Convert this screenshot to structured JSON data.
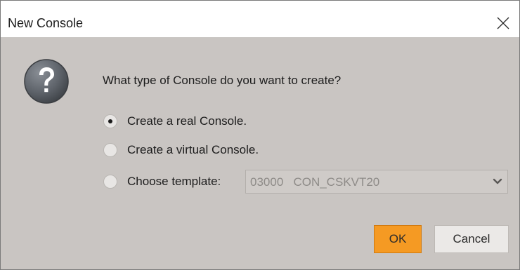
{
  "window": {
    "title": "New Console",
    "close_icon": "close-icon"
  },
  "dialog": {
    "icon": "question-icon",
    "prompt": "What type of Console do you want to create?",
    "options": [
      {
        "label": "Create a real Console.",
        "checked": true
      },
      {
        "label": "Create a virtual Console.",
        "checked": false
      },
      {
        "label": "Choose template:",
        "checked": false
      }
    ],
    "template_select": {
      "value": "03000   CON_CSKVT20",
      "enabled": false,
      "icon": "chevron-down-icon"
    }
  },
  "buttons": {
    "ok_label": "OK",
    "cancel_label": "Cancel"
  },
  "colors": {
    "dialog_background": "#c9c5c2",
    "ok_button": "#f59a23",
    "cancel_button": "#ebe9e7"
  }
}
